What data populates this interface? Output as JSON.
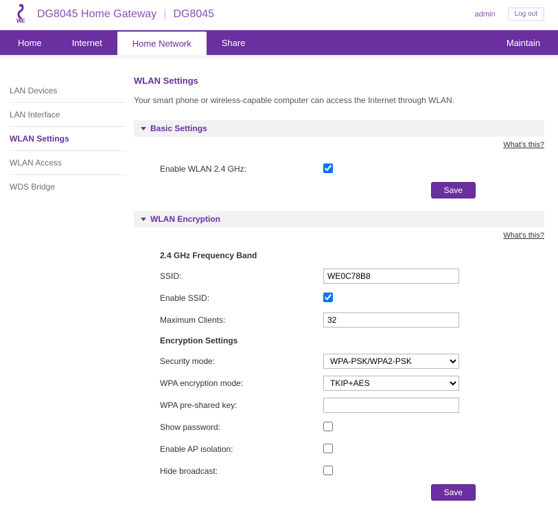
{
  "header": {
    "logo_text": "WE",
    "product": "DG8045 Home Gateway",
    "model": "DG8045",
    "user": "admin",
    "logout": "Log out"
  },
  "nav": {
    "items": [
      {
        "label": "Home"
      },
      {
        "label": "Internet"
      },
      {
        "label": "Home Network"
      },
      {
        "label": "Share"
      }
    ],
    "right": {
      "label": "Maintain"
    }
  },
  "sidebar": {
    "items": [
      {
        "label": "LAN Devices"
      },
      {
        "label": "LAN Interface"
      },
      {
        "label": "WLAN Settings"
      },
      {
        "label": "WLAN Access"
      },
      {
        "label": "WDS Bridge"
      }
    ]
  },
  "page": {
    "title": "WLAN Settings",
    "desc": "Your smart phone or wireless-capable computer can access the Internet through WLAN.",
    "whats": "What's this?"
  },
  "basic": {
    "title": "Basic Settings",
    "enable_label": "Enable WLAN 2.4 GHz:",
    "save": "Save"
  },
  "enc": {
    "title": "WLAN Encryption",
    "band": "2.4 GHz Frequency Band",
    "ssid_label": "SSID:",
    "ssid_value": "WE0C78B8",
    "enable_ssid_label": "Enable SSID:",
    "max_clients_label": "Maximum Clients:",
    "max_clients_value": "32",
    "enc_settings": "Encryption Settings",
    "sec_mode_label": "Security mode:",
    "sec_mode_value": "WPA-PSK/WPA2-PSK",
    "wpa_mode_label": "WPA encryption mode:",
    "wpa_mode_value": "TKIP+AES",
    "psk_label": "WPA pre-shared key:",
    "show_pwd_label": "Show password:",
    "ap_iso_label": "Enable AP isolation:",
    "hide_label": "Hide broadcast:",
    "save": "Save"
  }
}
